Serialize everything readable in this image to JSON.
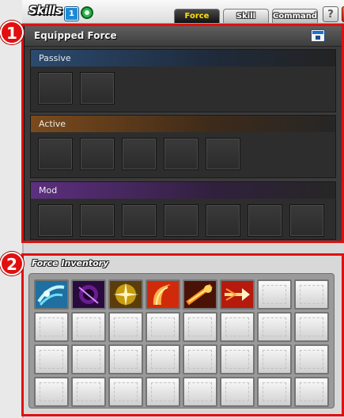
{
  "window": {
    "title": "Skills",
    "badge_number": "1",
    "badge_ring_icon": "green-refresh-icon",
    "tabs": [
      {
        "label": "Force",
        "active": true
      },
      {
        "label": "Skill",
        "active": false
      },
      {
        "label": "Command",
        "active": false
      }
    ],
    "help_label": "?",
    "close_label": "✕"
  },
  "equipped": {
    "title": "Equipped Force",
    "header_icon": "film-clapper-icon",
    "sections": [
      {
        "label": "Passive",
        "slots": 2,
        "accent": "#2a4a6f"
      },
      {
        "label": "Active",
        "slots": 5,
        "accent": "#7b4a1b"
      },
      {
        "label": "Mod",
        "slots": 7,
        "accent": "#5d2f80"
      }
    ]
  },
  "inventory": {
    "label": "Force Inventory",
    "rows": 4,
    "columns": 8,
    "skills": [
      {
        "name": "wind-slash-skill-icon",
        "color": "#1f6fa0"
      },
      {
        "name": "dark-orb-skill-icon",
        "color": "#6a1d8f"
      },
      {
        "name": "holy-star-skill-icon",
        "color": "#c79b12"
      },
      {
        "name": "crescent-fire-skill-icon",
        "color": "#d12a0a"
      },
      {
        "name": "flame-burst-skill-icon",
        "color": "#c2560c"
      },
      {
        "name": "fire-arrow-skill-icon",
        "color": "#b51a0c"
      }
    ]
  },
  "annotations": [
    {
      "label": "1",
      "color": "#e10f0f"
    },
    {
      "label": "2",
      "color": "#e10f0f"
    }
  ]
}
